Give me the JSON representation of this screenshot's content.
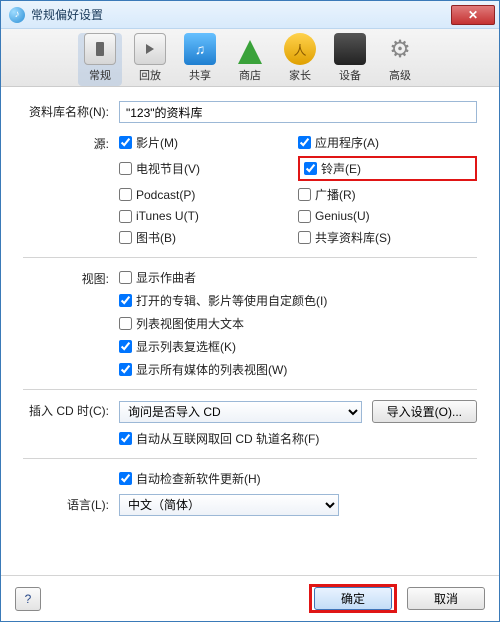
{
  "window": {
    "title": "常规偏好设置",
    "close_glyph": "✕"
  },
  "toolbar": {
    "items": [
      {
        "label": "常规"
      },
      {
        "label": "回放"
      },
      {
        "label": "共享"
      },
      {
        "label": "商店"
      },
      {
        "label": "家长"
      },
      {
        "label": "设备"
      },
      {
        "label": "高级"
      }
    ]
  },
  "library_name": {
    "label": "资料库名称(N):",
    "value": "\"123\"的资料库"
  },
  "sources": {
    "label": "源:",
    "items": [
      {
        "label": "影片(M)",
        "checked": true
      },
      {
        "label": "应用程序(A)",
        "checked": true
      },
      {
        "label": "电视节目(V)",
        "checked": false
      },
      {
        "label": "铃声(E)",
        "checked": true
      },
      {
        "label": "Podcast(P)",
        "checked": false
      },
      {
        "label": "广播(R)",
        "checked": false
      },
      {
        "label": "iTunes U(T)",
        "checked": false
      },
      {
        "label": "Genius(U)",
        "checked": false
      },
      {
        "label": "图书(B)",
        "checked": false
      },
      {
        "label": "共享资料库(S)",
        "checked": false
      }
    ]
  },
  "views": {
    "label": "视图:",
    "items": [
      {
        "label": "显示作曲者",
        "checked": false
      },
      {
        "label": "打开的专辑、影片等使用自定颜色(I)",
        "checked": true
      },
      {
        "label": "列表视图使用大文本",
        "checked": false
      },
      {
        "label": "显示列表复选框(K)",
        "checked": true
      },
      {
        "label": "显示所有媒体的列表视图(W)",
        "checked": true
      }
    ]
  },
  "cd_insert": {
    "label": "插入 CD 时(C):",
    "selected": "询问是否导入 CD",
    "import_btn": "导入设置(O)...",
    "auto_fetch": {
      "label": "自动从互联网取回 CD 轨道名称(F)",
      "checked": true
    }
  },
  "updates": {
    "auto_check": {
      "label": "自动检查新软件更新(H)",
      "checked": true
    }
  },
  "language": {
    "label": "语言(L):",
    "selected": "中文（简体）"
  },
  "footer": {
    "help": "?",
    "ok": "确定",
    "cancel": "取消"
  }
}
